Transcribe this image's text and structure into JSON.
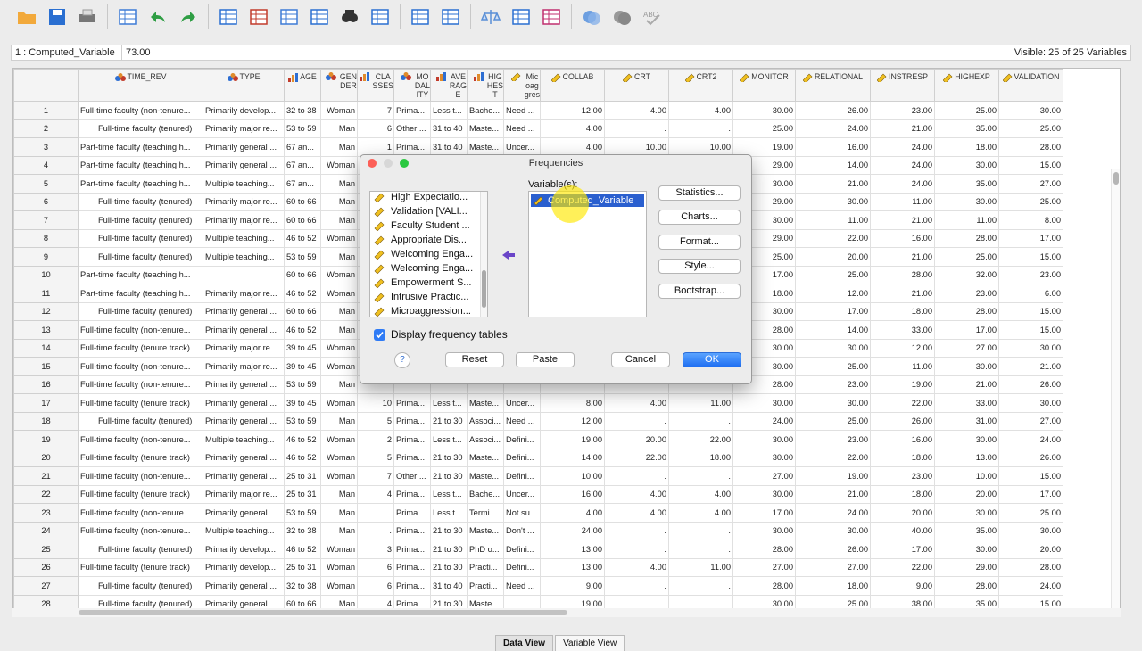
{
  "toolbar": {
    "icons": [
      "open-folder",
      "save",
      "print",
      "recall-dialog",
      "undo",
      "redo",
      "goto-case",
      "goto-variable",
      "variables",
      "run-descriptives",
      "find",
      "insert-cases",
      "insert-variable",
      "split-file",
      "weight-cases",
      "select-cases",
      "value-labels",
      "use-sets",
      "show-all-variables",
      "spell-check"
    ]
  },
  "cell_editor": {
    "cell_name": "1 : Computed_Variable",
    "cell_value": "73.00",
    "visible_text": "Visible: 25 of 25 Variables"
  },
  "grid": {
    "columns": [
      {
        "label": "TIME_REV",
        "type": "nominal"
      },
      {
        "label": "TYPE",
        "type": "nominal"
      },
      {
        "label": "AGE",
        "type": "ordinal"
      },
      {
        "label": "GEN\nDER",
        "type": "nominal"
      },
      {
        "label": "CLA\nSSES",
        "type": "ordinal"
      },
      {
        "label": "MO\nDAL\nITY",
        "type": "nominal"
      },
      {
        "label": "AVE\nRAG\nE",
        "type": "ordinal"
      },
      {
        "label": "HIG\nHES\nT",
        "type": "ordinal"
      },
      {
        "label": "Mic\noag\ngres",
        "type": "scale"
      },
      {
        "label": "COLLAB",
        "type": "scale"
      },
      {
        "label": "CRT",
        "type": "scale"
      },
      {
        "label": "CRT2",
        "type": "scale"
      },
      {
        "label": "MONITOR",
        "type": "scale"
      },
      {
        "label": "RELATIONAL",
        "type": "scale"
      },
      {
        "label": "INSTRESP",
        "type": "scale"
      },
      {
        "label": "HIGHEXP",
        "type": "scale"
      },
      {
        "label": "VALIDATION",
        "type": "scale"
      }
    ],
    "rows": [
      [
        "Full-time faculty (non-tenure...",
        "Primarily develop...",
        "32 to 38",
        "Woman",
        "7",
        "Prima...",
        "Less t...",
        "Bache...",
        "Need ...",
        "12.00",
        "4.00",
        "4.00",
        "30.00",
        "26.00",
        "23.00",
        "25.00",
        "30.00"
      ],
      [
        "Full-time faculty (tenured)",
        "Primarily major re...",
        "53 to 59",
        "Man",
        "6",
        "Other ...",
        "31 to 40",
        "Maste...",
        "Need ...",
        "4.00",
        ".",
        ".",
        "25.00",
        "24.00",
        "21.00",
        "35.00",
        "25.00"
      ],
      [
        "Part-time faculty (teaching h...",
        "Primarily general ...",
        "67 an...",
        "Man",
        "1",
        "Prima...",
        "31 to 40",
        "Maste...",
        "Uncer...",
        "4.00",
        "10.00",
        "10.00",
        "19.00",
        "16.00",
        "24.00",
        "18.00",
        "28.00"
      ],
      [
        "Part-time faculty (teaching h...",
        "Primarily general ...",
        "67 an...",
        "Woman",
        "",
        "",
        "",
        "",
        "",
        "",
        "",
        "",
        "29.00",
        "14.00",
        "24.00",
        "30.00",
        "15.00"
      ],
      [
        "Part-time faculty (teaching h...",
        "Multiple teaching...",
        "67 an...",
        "Man",
        "",
        "",
        "",
        "",
        "",
        "",
        "",
        "",
        "30.00",
        "21.00",
        "24.00",
        "35.00",
        "27.00"
      ],
      [
        "Full-time faculty (tenured)",
        "Primarily major re...",
        "60 to 66",
        "Man",
        "",
        "",
        "",
        "",
        "",
        "",
        "",
        "",
        "29.00",
        "30.00",
        "11.00",
        "30.00",
        "25.00"
      ],
      [
        "Full-time faculty (tenured)",
        "Primarily major re...",
        "60 to 66",
        "Man",
        "",
        "",
        "",
        "",
        "",
        "",
        "",
        "",
        "30.00",
        "11.00",
        "21.00",
        "11.00",
        "8.00"
      ],
      [
        "Full-time faculty (tenured)",
        "Multiple teaching...",
        "46 to 52",
        "Woman",
        "",
        "",
        "",
        "",
        "",
        "",
        "",
        "",
        "29.00",
        "22.00",
        "16.00",
        "28.00",
        "17.00"
      ],
      [
        "Full-time faculty (tenured)",
        "Multiple teaching...",
        "53 to 59",
        "Man",
        "",
        "",
        "",
        "",
        "",
        "",
        "",
        "",
        "25.00",
        "20.00",
        "21.00",
        "25.00",
        "15.00"
      ],
      [
        "Part-time faculty (teaching h...",
        "",
        "60 to 66",
        "Woman",
        "",
        "",
        "",
        "",
        "",
        "",
        "",
        "",
        "17.00",
        "25.00",
        "28.00",
        "32.00",
        "23.00"
      ],
      [
        "Part-time faculty (teaching h...",
        "Primarily major re...",
        "46 to 52",
        "Woman",
        "",
        "",
        "",
        "",
        "",
        "",
        "",
        "",
        "18.00",
        "12.00",
        "21.00",
        "23.00",
        "6.00"
      ],
      [
        "Full-time faculty (tenured)",
        "Primarily general ...",
        "60 to 66",
        "Man",
        "",
        "",
        "",
        "",
        "",
        "",
        "",
        "",
        "30.00",
        "17.00",
        "18.00",
        "28.00",
        "15.00"
      ],
      [
        "Full-time faculty (non-tenure...",
        "Primarily general ...",
        "46 to 52",
        "Man",
        "",
        "",
        "",
        "",
        "",
        "",
        "",
        "",
        "28.00",
        "14.00",
        "33.00",
        "17.00",
        "15.00"
      ],
      [
        "Full-time faculty (tenure track)",
        "Primarily major re...",
        "39 to 45",
        "Woman",
        "",
        "",
        "",
        "",
        "",
        "",
        "",
        "",
        "30.00",
        "30.00",
        "12.00",
        "27.00",
        "30.00"
      ],
      [
        "Full-time faculty (non-tenure...",
        "Primarily major re...",
        "39 to 45",
        "Woman",
        "",
        "",
        "",
        "",
        "",
        "",
        "",
        "",
        "30.00",
        "25.00",
        "11.00",
        "30.00",
        "21.00"
      ],
      [
        "Full-time faculty (non-tenure...",
        "Primarily general ...",
        "53 to 59",
        "Man",
        "",
        "",
        "",
        "",
        "",
        "",
        "",
        "",
        "28.00",
        "23.00",
        "19.00",
        "21.00",
        "26.00"
      ],
      [
        "Full-time faculty (tenure track)",
        "Primarily general ...",
        "39 to 45",
        "Woman",
        "10",
        "Prima...",
        "Less t...",
        "Maste...",
        "Uncer...",
        "8.00",
        "4.00",
        "11.00",
        "30.00",
        "30.00",
        "22.00",
        "33.00",
        "30.00"
      ],
      [
        "Full-time faculty (tenured)",
        "Primarily general ...",
        "53 to 59",
        "Man",
        "5",
        "Prima...",
        "21 to 30",
        "Associ...",
        "Need ...",
        "12.00",
        ".",
        ".",
        "24.00",
        "25.00",
        "26.00",
        "31.00",
        "27.00"
      ],
      [
        "Full-time faculty (non-tenure...",
        "Multiple teaching...",
        "46 to 52",
        "Woman",
        "2",
        "Prima...",
        "Less t...",
        "Associ...",
        "Defini...",
        "19.00",
        "20.00",
        "22.00",
        "30.00",
        "23.00",
        "16.00",
        "30.00",
        "24.00"
      ],
      [
        "Full-time faculty (tenure track)",
        "Primarily general ...",
        "46 to 52",
        "Woman",
        "5",
        "Prima...",
        "21 to 30",
        "Maste...",
        "Defini...",
        "14.00",
        "22.00",
        "18.00",
        "30.00",
        "22.00",
        "18.00",
        "13.00",
        "26.00"
      ],
      [
        "Full-time faculty (non-tenure...",
        "Primarily general ...",
        "25 to 31",
        "Woman",
        "7",
        "Other ...",
        "21 to 30",
        "Maste...",
        "Defini...",
        "10.00",
        ".",
        ".",
        "27.00",
        "19.00",
        "23.00",
        "10.00",
        "15.00"
      ],
      [
        "Full-time faculty (tenure track)",
        "Primarily major re...",
        "25 to 31",
        "Man",
        "4",
        "Prima...",
        "Less t...",
        "Bache...",
        "Uncer...",
        "16.00",
        "4.00",
        "4.00",
        "30.00",
        "21.00",
        "18.00",
        "20.00",
        "17.00"
      ],
      [
        "Full-time faculty (non-tenure...",
        "Primarily general ...",
        "53 to 59",
        "Man",
        ".",
        "Prima...",
        "Less t...",
        "Termi...",
        "Not su...",
        "4.00",
        "4.00",
        "4.00",
        "17.00",
        "24.00",
        "20.00",
        "30.00",
        "25.00"
      ],
      [
        "Full-time faculty (non-tenure...",
        "Multiple teaching...",
        "32 to 38",
        "Man",
        ".",
        "Prima...",
        "21 to 30",
        "Maste...",
        "Don't ...",
        "24.00",
        ".",
        ".",
        "30.00",
        "30.00",
        "40.00",
        "35.00",
        "30.00"
      ],
      [
        "Full-time faculty (tenured)",
        "Primarily develop...",
        "46 to 52",
        "Woman",
        "3",
        "Prima...",
        "21 to 30",
        "PhD o...",
        "Defini...",
        "13.00",
        ".",
        ".",
        "28.00",
        "26.00",
        "17.00",
        "30.00",
        "20.00"
      ],
      [
        "Full-time faculty (tenure track)",
        "Primarily develop...",
        "25 to 31",
        "Woman",
        "6",
        "Prima...",
        "21 to 30",
        "Practi...",
        "Defini...",
        "13.00",
        "4.00",
        "11.00",
        "27.00",
        "27.00",
        "22.00",
        "29.00",
        "28.00"
      ],
      [
        "Full-time faculty (tenured)",
        "Primarily general ...",
        "32 to 38",
        "Woman",
        "6",
        "Prima...",
        "31 to 40",
        "Practi...",
        "Need ...",
        "9.00",
        ".",
        ".",
        "28.00",
        "18.00",
        "9.00",
        "28.00",
        "24.00"
      ],
      [
        "Full-time faculty (tenured)",
        "Primarily general ...",
        "60 to 66",
        "Man",
        "4",
        "Prima...",
        "21 to 30",
        "Maste...",
        ".",
        "19.00",
        ".",
        ".",
        "30.00",
        "25.00",
        "38.00",
        "35.00",
        "15.00"
      ]
    ]
  },
  "bottom_tabs": [
    "Data View",
    "Variable View"
  ],
  "dialog": {
    "title": "Frequencies",
    "source_items": [
      "High Expectatio...",
      "Validation [VALI...",
      "Faculty Student ...",
      "Appropriate Dis...",
      "Welcoming Enga...",
      "Welcoming Enga...",
      "Empowerment S...",
      "Intrusive Practic...",
      "Microaggression..."
    ],
    "variables_label": "Variable(s):",
    "selected_variable": "Computed_Variable",
    "side_buttons": [
      "Statistics...",
      "Charts...",
      "Format...",
      "Style...",
      "Bootstrap..."
    ],
    "checkbox_label": "Display frequency tables",
    "checkbox_checked": true,
    "help_label": "?",
    "reset_label": "Reset",
    "paste_label": "Paste",
    "cancel_label": "Cancel",
    "ok_label": "OK"
  }
}
